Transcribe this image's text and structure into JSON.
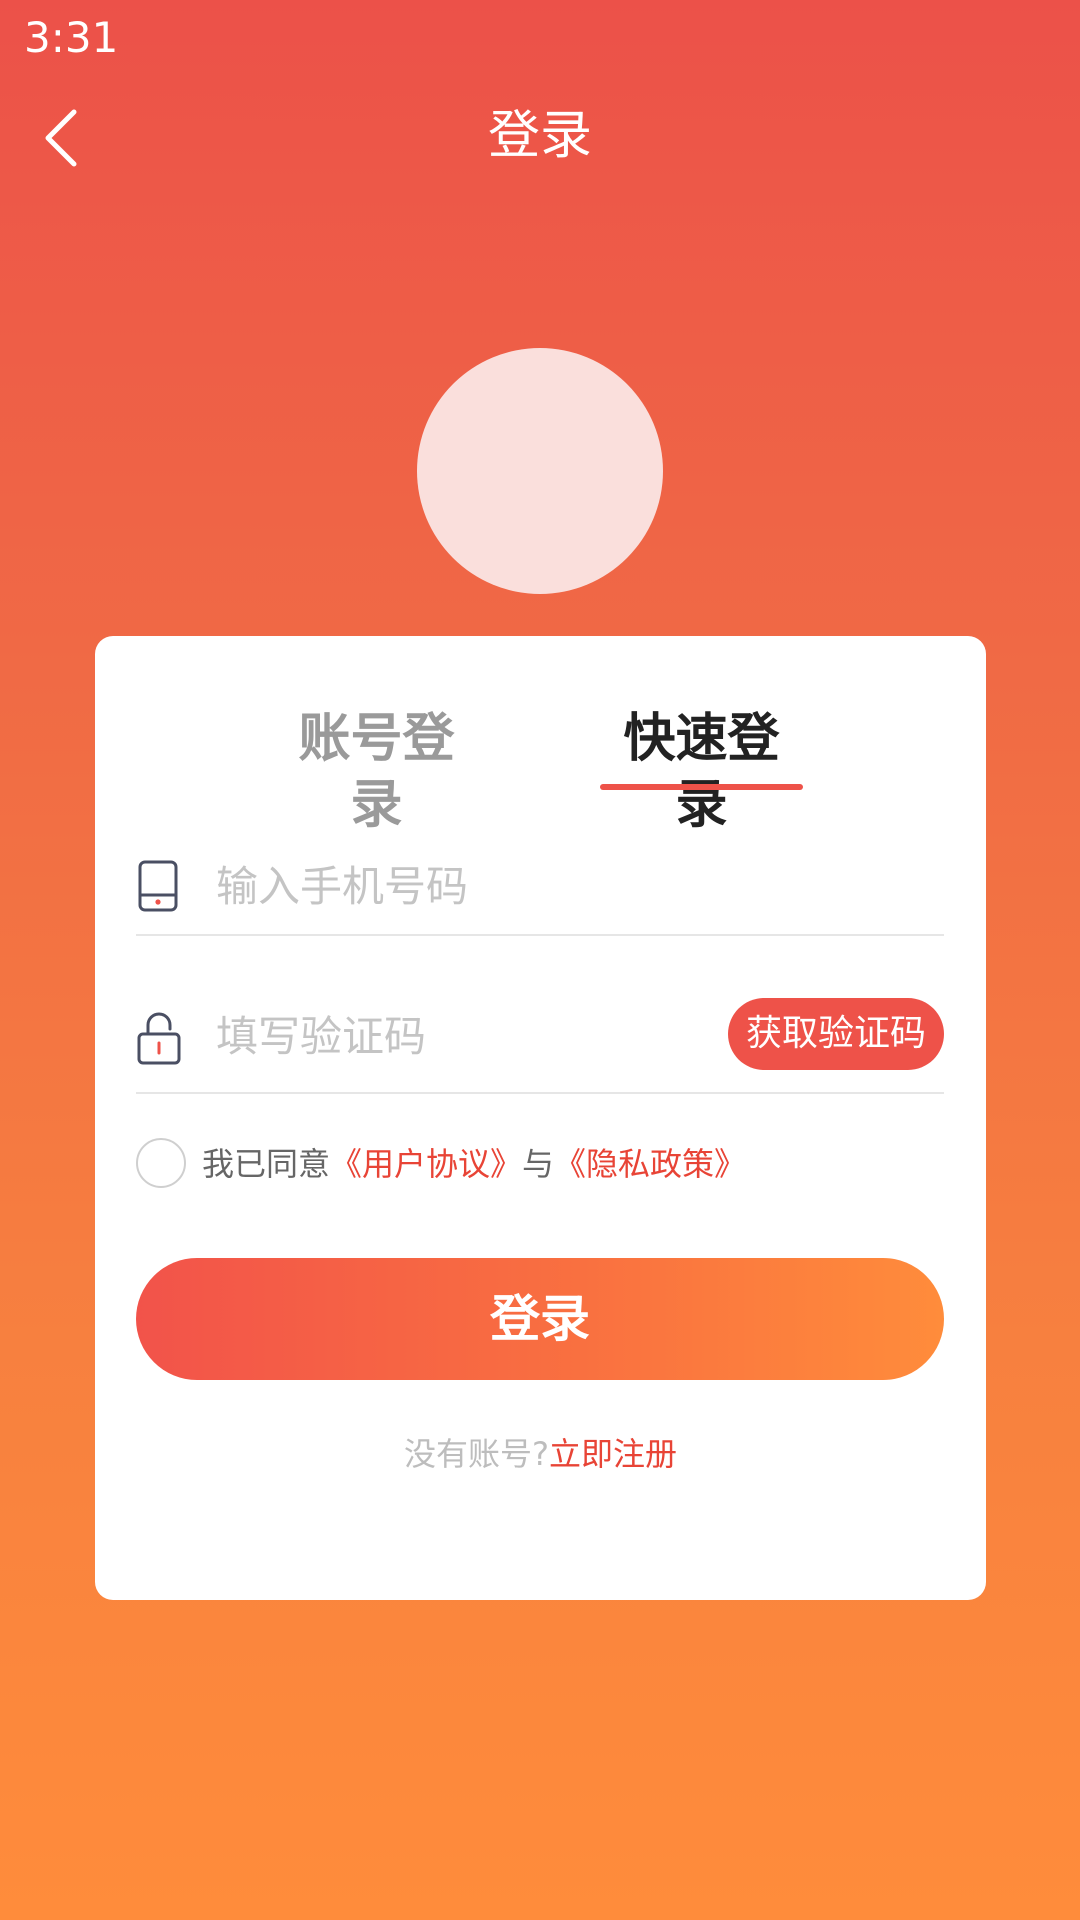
{
  "status_bar": {
    "time": "3:31"
  },
  "header": {
    "title": "登录",
    "back_icon": "chevron-left-icon"
  },
  "tabs": [
    {
      "label": "账号登录",
      "active": false
    },
    {
      "label": "快速登录",
      "active": true
    }
  ],
  "phone_field": {
    "placeholder": "输入手机号码",
    "value": "",
    "icon": "phone-icon"
  },
  "code_field": {
    "placeholder": "填写验证码",
    "value": "",
    "icon": "lock-icon",
    "button_label": "获取验证码"
  },
  "agreement": {
    "prefix": "我已同意",
    "user_agreement": "《用户协议》",
    "conjunction": "与",
    "privacy_policy": "《隐私政策》",
    "checked": false
  },
  "login_button": {
    "label": "登录"
  },
  "register": {
    "prompt": "没有账号?",
    "link": "立即注册"
  },
  "colors": {
    "accent": "#ee5249",
    "gradient_top": "#ec5149",
    "gradient_bottom": "#ff8c3b",
    "link": "#e84436",
    "avatar_fill": "#fadfdc"
  }
}
